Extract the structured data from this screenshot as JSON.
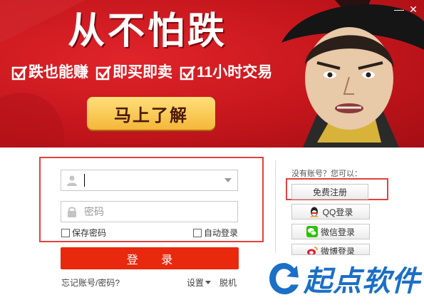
{
  "banner": {
    "headline": "从不怕跌",
    "features": [
      {
        "label": "跌也能赚"
      },
      {
        "label": "即买即卖"
      },
      {
        "label": "11小时交易"
      }
    ],
    "cta_label": "马上了解"
  },
  "window": {
    "minimize_glyph": "—",
    "close_glyph": "✕"
  },
  "login": {
    "username_value": "",
    "password_placeholder": "密码",
    "remember_password_label": "保存密码",
    "auto_login_label": "自动登录",
    "login_button_label": "登 录",
    "forgot_link": "忘记账号/密码?",
    "settings_link": "设置",
    "offline_link": "脱机"
  },
  "side": {
    "prompt": "没有账号？您可以：",
    "register_label": "免费注册",
    "qq_label": "QQ登录",
    "wechat_label": "微信登录",
    "weibo_label": "微博登录"
  },
  "watermark": {
    "text": "起点软件"
  },
  "colors": {
    "banner_red": "#c4161c",
    "cta_yellow": "#f4b73a",
    "login_button": "#e8290e",
    "highlight_border": "#e0423e",
    "watermark_blue": "#1b6fc6"
  },
  "icons": {
    "user": "user-icon",
    "lock": "lock-icon",
    "dropdown": "chevron-down-icon",
    "qq": "qq-penguin-icon",
    "wechat": "wechat-icon",
    "weibo": "weibo-icon",
    "check": "check-mark-icon"
  }
}
